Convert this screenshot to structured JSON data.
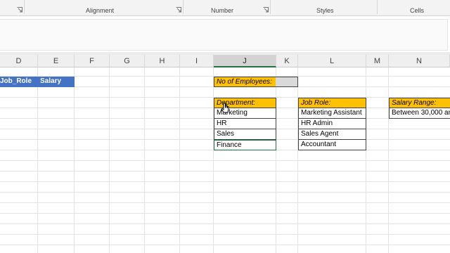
{
  "ribbon": {
    "groups": [
      "Alignment",
      "Number",
      "Styles",
      "Cells"
    ]
  },
  "columns": [
    "D",
    "E",
    "F",
    "G",
    "H",
    "I",
    "J",
    "K",
    "L",
    "M",
    "N"
  ],
  "selected_column": "J",
  "headers": {
    "job_role": "Job_Role",
    "salary": "Salary"
  },
  "no_of_employees": {
    "label": "No of Employees:",
    "value": ""
  },
  "department": {
    "label": "Department:",
    "items": [
      "Marketing",
      "HR",
      "Sales",
      "Finance"
    ]
  },
  "job_role": {
    "label": "Job Role:",
    "items": [
      "Marketing Assistant",
      "HR Admin",
      "Sales Agent",
      "Accountant"
    ]
  },
  "salary_range": {
    "label": "Salary Range:",
    "value": "Between 30,000 an"
  },
  "colors": {
    "header_blue": "#4472c4",
    "label_orange": "#ffc000",
    "selection_green": "#217346"
  }
}
